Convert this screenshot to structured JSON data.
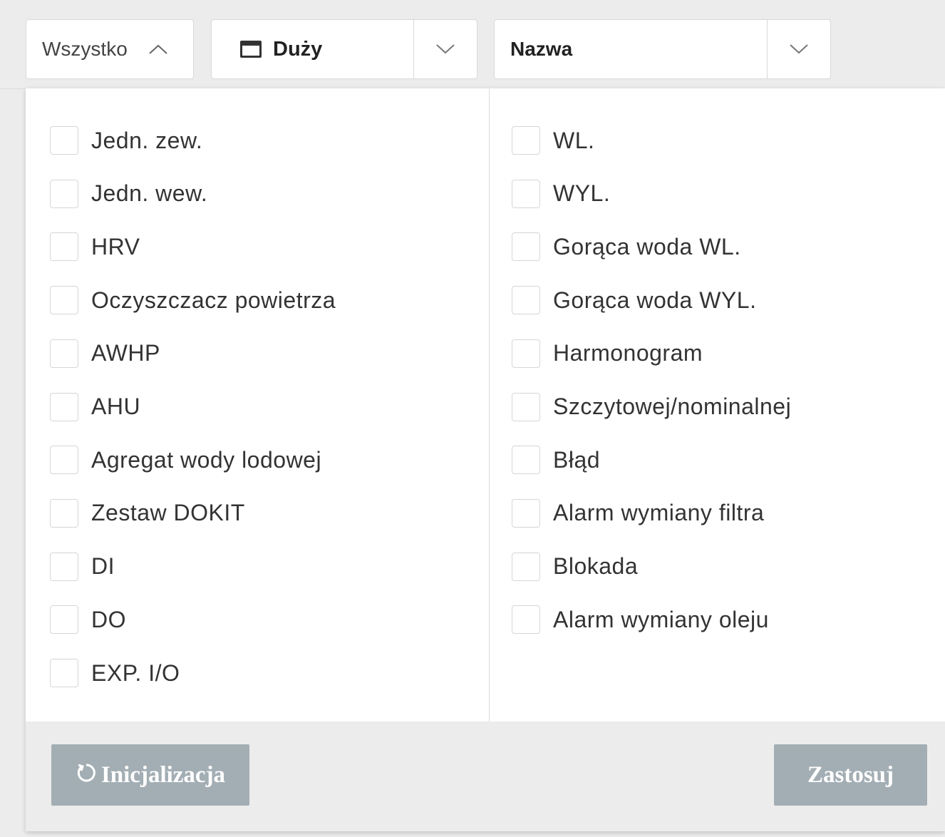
{
  "toolbar": {
    "filter_label": "Wszystko",
    "size_label": "Duży",
    "sort_label": "Nazwa"
  },
  "filters": {
    "left": [
      {
        "label": "Jedn. zew.",
        "checked": false
      },
      {
        "label": "Jedn. wew.",
        "checked": false
      },
      {
        "label": "HRV",
        "checked": false
      },
      {
        "label": "Oczyszczacz powietrza",
        "checked": false
      },
      {
        "label": "AWHP",
        "checked": false
      },
      {
        "label": "AHU",
        "checked": false
      },
      {
        "label": "Agregat wody lodowej",
        "checked": false
      },
      {
        "label": "Zestaw DOKIT",
        "checked": false
      },
      {
        "label": "DI",
        "checked": false
      },
      {
        "label": "DO",
        "checked": false
      },
      {
        "label": "EXP. I/O",
        "checked": false
      }
    ],
    "right": [
      {
        "label": "WL.",
        "checked": false
      },
      {
        "label": "WYL.",
        "checked": false
      },
      {
        "label": "Gorąca woda WL.",
        "checked": false
      },
      {
        "label": "Gorąca woda WYL.",
        "checked": false
      },
      {
        "label": "Harmonogram",
        "checked": false
      },
      {
        "label": "Szczytowej/nominalnej",
        "checked": false
      },
      {
        "label": "Błąd",
        "checked": false
      },
      {
        "label": "Alarm wymiany filtra",
        "checked": false
      },
      {
        "label": "Blokada",
        "checked": false
      },
      {
        "label": "Alarm wymiany oleju",
        "checked": false
      }
    ]
  },
  "footer": {
    "reset_label": "Inicjalizacja",
    "apply_label": "Zastosuj"
  },
  "colors": {
    "button_bg": "#a3aeb4",
    "panel_bg": "#ffffff",
    "toolbar_bg": "#ececec"
  }
}
